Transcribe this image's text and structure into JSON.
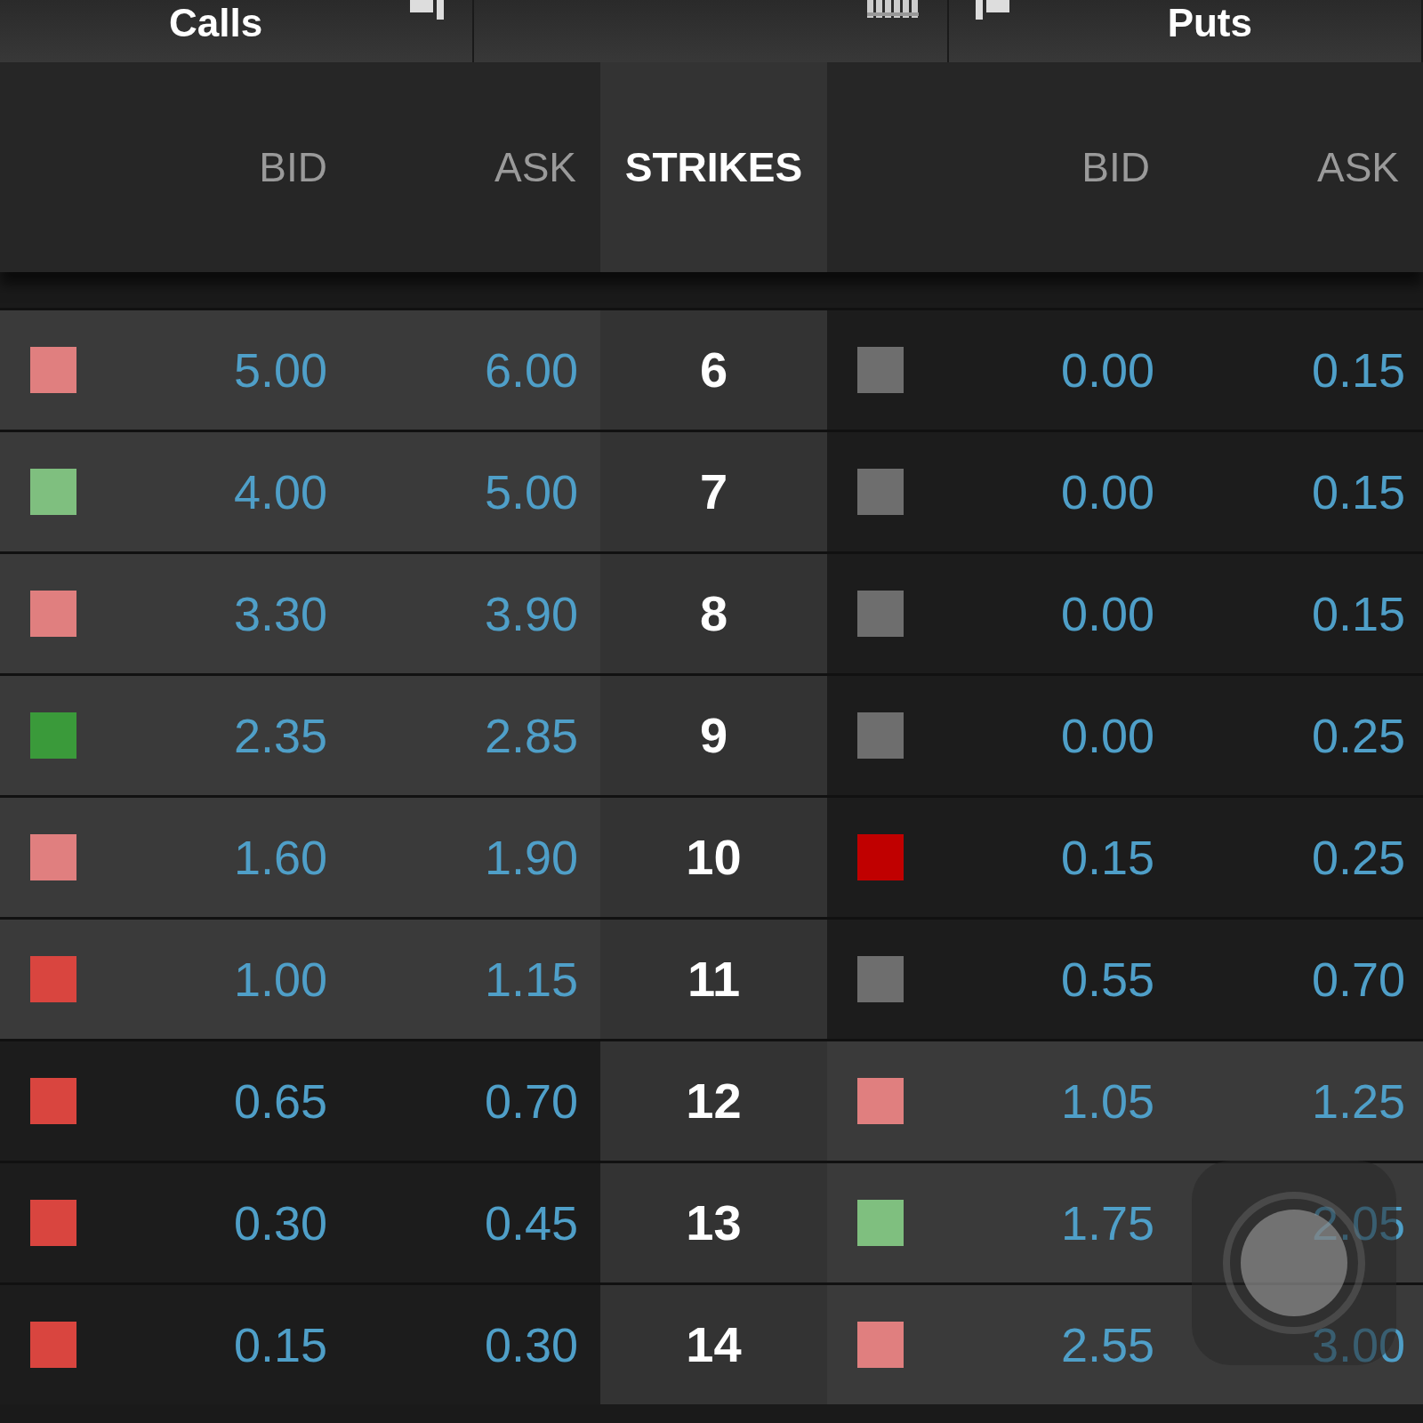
{
  "tabs": [
    {
      "label": "Calls",
      "kind": "bars"
    },
    {
      "kind": "grid"
    },
    {
      "label": "Puts",
      "kind": "flag"
    }
  ],
  "columns": {
    "calls": [
      "BID",
      "ASK"
    ],
    "strike": "STRIKES",
    "puts": [
      "BID",
      "ASK"
    ]
  },
  "rows": [
    {
      "strike": "6",
      "call": {
        "color": "#e07f7f",
        "bid": "5.00",
        "ask": "6.00",
        "in_the_money": true
      },
      "put": {
        "color": "#6e6e6e",
        "bid": "0.00",
        "ask": "0.15",
        "in_the_money": false
      }
    },
    {
      "strike": "7",
      "call": {
        "color": "#7fbf7f",
        "bid": "4.00",
        "ask": "5.00",
        "in_the_money": true
      },
      "put": {
        "color": "#6e6e6e",
        "bid": "0.00",
        "ask": "0.15",
        "in_the_money": false
      }
    },
    {
      "strike": "8",
      "call": {
        "color": "#e07f7f",
        "bid": "3.30",
        "ask": "3.90",
        "in_the_money": true
      },
      "put": {
        "color": "#6e6e6e",
        "bid": "0.00",
        "ask": "0.15",
        "in_the_money": false
      }
    },
    {
      "strike": "9",
      "call": {
        "color": "#3a9a3a",
        "bid": "2.35",
        "ask": "2.85",
        "in_the_money": true
      },
      "put": {
        "color": "#6e6e6e",
        "bid": "0.00",
        "ask": "0.25",
        "in_the_money": false
      }
    },
    {
      "strike": "10",
      "call": {
        "color": "#e07f7f",
        "bid": "1.60",
        "ask": "1.90",
        "in_the_money": true
      },
      "put": {
        "color": "#c00000",
        "bid": "0.15",
        "ask": "0.25",
        "in_the_money": false
      }
    },
    {
      "strike": "11",
      "call": {
        "color": "#d9453f",
        "bid": "1.00",
        "ask": "1.15",
        "in_the_money": true
      },
      "put": {
        "color": "#6e6e6e",
        "bid": "0.55",
        "ask": "0.70",
        "in_the_money": false
      }
    },
    {
      "strike": "12",
      "call": {
        "color": "#d9453f",
        "bid": "0.65",
        "ask": "0.70",
        "in_the_money": false
      },
      "put": {
        "color": "#e07f7f",
        "bid": "1.05",
        "ask": "1.25",
        "in_the_money": true
      }
    },
    {
      "strike": "13",
      "call": {
        "color": "#d9453f",
        "bid": "0.30",
        "ask": "0.45",
        "in_the_money": false
      },
      "put": {
        "color": "#7fbf7f",
        "bid": "1.75",
        "ask": "2.05",
        "in_the_money": true
      }
    },
    {
      "strike": "14",
      "call": {
        "color": "#d9453f",
        "bid": "0.15",
        "ask": "0.30",
        "in_the_money": false
      },
      "put": {
        "color": "#e07f7f",
        "bid": "2.55",
        "ask": "3.00",
        "in_the_money": true
      }
    }
  ]
}
